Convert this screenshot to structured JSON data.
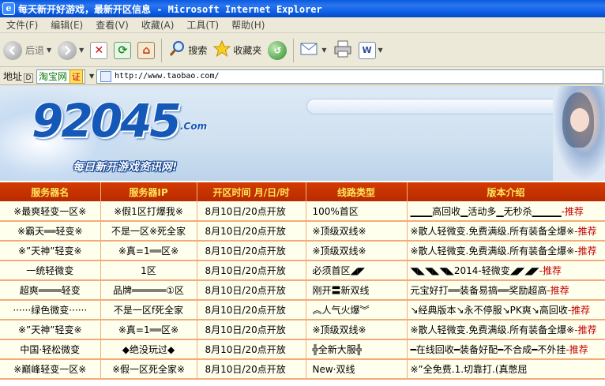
{
  "window": {
    "title": "每天新开好游戏，最新开区信息 - Microsoft Internet Explorer",
    "icon": "ie-icon"
  },
  "menu": [
    "文件(F)",
    "编辑(E)",
    "查看(V)",
    "收藏(A)",
    "工具(T)",
    "帮助(H)"
  ],
  "toolbar": {
    "back_label": "后退",
    "search_label": "搜索",
    "favorites_label": "收藏夹",
    "icons": [
      "back-icon",
      "forward-icon",
      "stop-icon",
      "refresh-icon",
      "home-icon",
      "search-icon",
      "favorites-icon",
      "history-icon",
      "mail-icon",
      "print-icon",
      "edit-icon"
    ]
  },
  "address": {
    "label": "地址",
    "shortcut": "D",
    "taobao_label": "淘宝网",
    "cert_badge": "证",
    "url": "http://www.taobao.com/"
  },
  "banner": {
    "logo": "92045",
    "logo_suffix": ".Com",
    "slogan": "每日新开游戏资讯网!"
  },
  "table": {
    "headers": [
      "服务器名",
      "服务器IP",
      "开区时间  月/日/时",
      "线路类型",
      "版本介绍"
    ],
    "rows": [
      {
        "name": "※最爽轻变一区※",
        "ip": "※假1区打爆我※",
        "time": "8月10日/20点开放",
        "line": "100%首区",
        "intro": "▁▁▁高回收▁活动多▁无秒杀▁▁▁▁",
        "rec": "-推荐"
      },
      {
        "name": "※霸天══轻变※",
        "ip": "不是一区※死全家",
        "time": "8月10日/20点开放",
        "line": "※顶级双线※",
        "intro": "※散人轻微变.免费满级.所有装备全爆※",
        "rec": "-推荐"
      },
      {
        "name": "※”天神”轻变※",
        "ip": "※真=1══区※",
        "time": "8月10日/20点开放",
        "line": "※顶级双线※",
        "intro": "※散人轻微变.免费满级.所有装备全爆※",
        "rec": "-推荐"
      },
      {
        "name": "一统轻微变",
        "ip": "1区",
        "time": "8月10日/20点开放",
        "line": "必须首区◢◤",
        "intro": "◥◣◥◣◥◣2014-轻微变◢◤◢◤",
        "rec": "-推荐"
      },
      {
        "name": "超爽════轻变",
        "ip": "品牌══════①区",
        "time": "8月10日/20点开放",
        "line": "刚开〓新双线",
        "intro": "元宝好打══装备易搞══奖励超高",
        "rec": "-推荐"
      },
      {
        "name": "······绿色微变······",
        "ip": "不是一区f死全家",
        "time": "8月10日/20点开放",
        "line": "︽人气火爆︾",
        "intro": "↘经典版本↘永不停服↘PK爽↘高回收",
        "rec": "-推荐"
      },
      {
        "name": "※”天神”轻变※",
        "ip": "※真=1══区※",
        "time": "8月10日/20点开放",
        "line": "※顶级双线※",
        "intro": "※散人轻微变.免费满级.所有装备全爆※",
        "rec": "-推荐"
      },
      {
        "name": "中国·轻松微变",
        "ip": "◆绝没玩过◆",
        "time": "8月10日/20点开放",
        "line": "╬全新大服╬",
        "intro": "━在线回收━装备好配━不合成━不外挂",
        "rec": "-推荐"
      },
      {
        "name": "※巅峰轻变一区※",
        "ip": "※假一区死全家※",
        "time": "8月10日/20点开放",
        "line": "New·双线",
        "intro": "※”全免费.1.切靠打.(真憋屈",
        "rec": ""
      }
    ]
  },
  "colors": {
    "title_bar": "#0b5fe6",
    "header_bg": "#c83400",
    "header_text": "#ffe75c",
    "row_bg": "#ffffee",
    "accent_red": "#c40000"
  }
}
